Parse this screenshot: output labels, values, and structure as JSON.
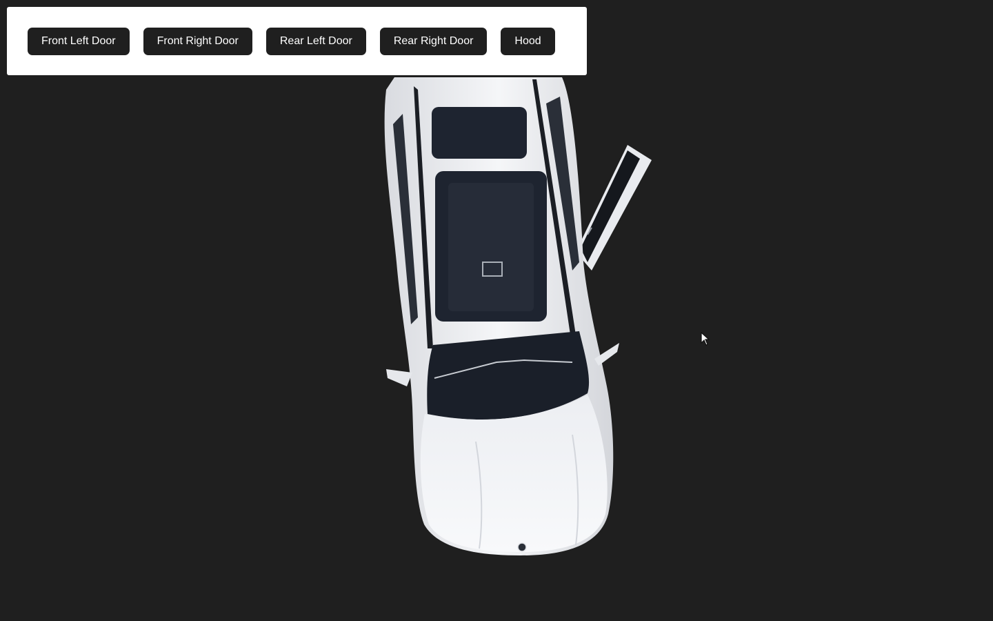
{
  "toolbar": {
    "buttons": [
      {
        "label": "Front Left Door"
      },
      {
        "label": "Front Right Door"
      },
      {
        "label": "Rear Left Door"
      },
      {
        "label": "Rear Right Door"
      },
      {
        "label": "Hood"
      }
    ]
  },
  "scene": {
    "background_color": "#1f1f1f",
    "car_color": "#f2f3f6",
    "glass_color": "#1e2430",
    "open_parts": [
      "front-right-door"
    ]
  },
  "icons": {
    "cursor": "mouse-pointer-icon",
    "emblem": "car-emblem-icon"
  }
}
